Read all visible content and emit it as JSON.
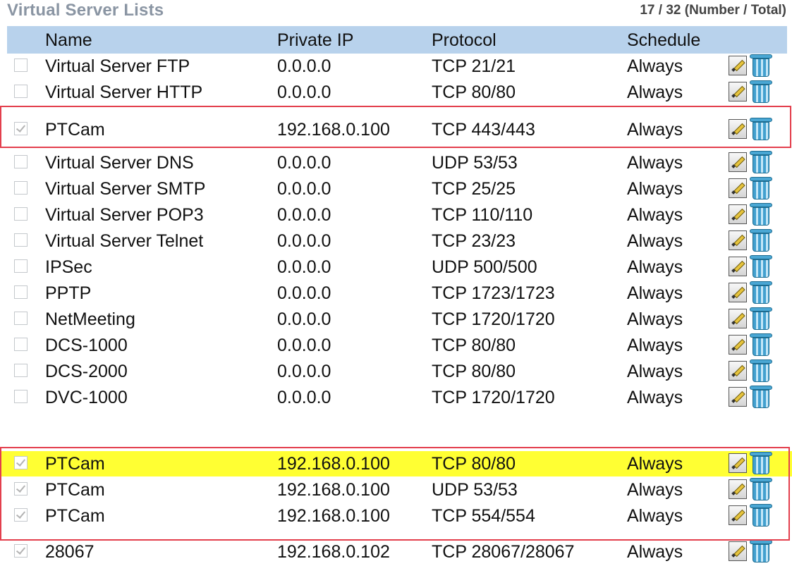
{
  "title": "Virtual Server Lists",
  "count_text": "17 / 32 (Number / Total)",
  "columns": {
    "name": "Name",
    "ip": "Private IP",
    "protocol": "Protocol",
    "schedule": "Schedule"
  },
  "icons": {
    "edit": "edit-pencil-icon",
    "delete": "trash-bin-icon"
  },
  "colors": {
    "header_bg": "#b8d2ec",
    "highlight": "#ffff33",
    "annotation_box": "#e33f4d"
  },
  "rows": [
    {
      "checked": false,
      "name": "Virtual Server FTP",
      "ip": "0.0.0.0",
      "protocol": "TCP 21/21",
      "schedule": "Always",
      "highlighted": false
    },
    {
      "checked": false,
      "name": "Virtual Server HTTP",
      "ip": "0.0.0.0",
      "protocol": "TCP 80/80",
      "schedule": "Always",
      "highlighted": false
    },
    {
      "checked": true,
      "name": "PTCam",
      "ip": "192.168.0.100",
      "protocol": "TCP 443/443",
      "schedule": "Always",
      "highlighted": false
    },
    {
      "checked": false,
      "name": "Virtual Server DNS",
      "ip": "0.0.0.0",
      "protocol": "UDP 53/53",
      "schedule": "Always",
      "highlighted": false
    },
    {
      "checked": false,
      "name": "Virtual Server SMTP",
      "ip": "0.0.0.0",
      "protocol": "TCP 25/25",
      "schedule": "Always",
      "highlighted": false
    },
    {
      "checked": false,
      "name": "Virtual Server POP3",
      "ip": "0.0.0.0",
      "protocol": "TCP 110/110",
      "schedule": "Always",
      "highlighted": false
    },
    {
      "checked": false,
      "name": "Virtual Server Telnet",
      "ip": "0.0.0.0",
      "protocol": "TCP 23/23",
      "schedule": "Always",
      "highlighted": false
    },
    {
      "checked": false,
      "name": "IPSec",
      "ip": "0.0.0.0",
      "protocol": "UDP 500/500",
      "schedule": "Always",
      "highlighted": false
    },
    {
      "checked": false,
      "name": "PPTP",
      "ip": "0.0.0.0",
      "protocol": "TCP 1723/1723",
      "schedule": "Always",
      "highlighted": false
    },
    {
      "checked": false,
      "name": "NetMeeting",
      "ip": "0.0.0.0",
      "protocol": "TCP 1720/1720",
      "schedule": "Always",
      "highlighted": false
    },
    {
      "checked": false,
      "name": "DCS-1000",
      "ip": "0.0.0.0",
      "protocol": "TCP 80/80",
      "schedule": "Always",
      "highlighted": false
    },
    {
      "checked": false,
      "name": "DCS-2000",
      "ip": "0.0.0.0",
      "protocol": "TCP 80/80",
      "schedule": "Always",
      "highlighted": false
    },
    {
      "checked": false,
      "name": "DVC-1000",
      "ip": "0.0.0.0",
      "protocol": "TCP 1720/1720",
      "schedule": "Always",
      "highlighted": false
    },
    {
      "checked": true,
      "name": "PTCam",
      "ip": "192.168.0.100",
      "protocol": "TCP 80/80",
      "schedule": "Always",
      "highlighted": true
    },
    {
      "checked": true,
      "name": "PTCam",
      "ip": "192.168.0.100",
      "protocol": "UDP 53/53",
      "schedule": "Always",
      "highlighted": false
    },
    {
      "checked": true,
      "name": "PTCam",
      "ip": "192.168.0.100",
      "protocol": "TCP 554/554",
      "schedule": "Always",
      "highlighted": false
    },
    {
      "checked": true,
      "name": "28067",
      "ip": "192.168.0.102",
      "protocol": "TCP 28067/28067",
      "schedule": "Always",
      "highlighted": false
    }
  ]
}
